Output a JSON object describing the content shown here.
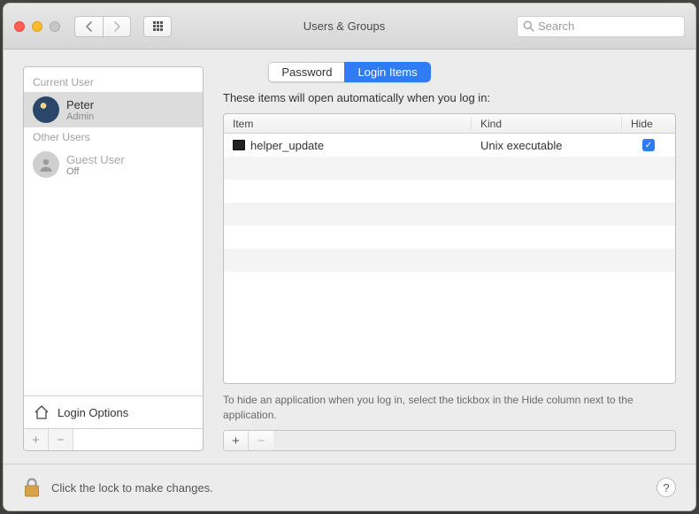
{
  "window": {
    "title": "Users & Groups"
  },
  "search": {
    "placeholder": "Search"
  },
  "tabs": {
    "password": "Password",
    "login_items": "Login Items"
  },
  "sidebar": {
    "current_label": "Current User",
    "other_label": "Other Users",
    "peter": {
      "name": "Peter",
      "role": "Admin"
    },
    "guest": {
      "name": "Guest User",
      "role": "Off"
    },
    "login_options": "Login Options"
  },
  "table": {
    "explain": "These items will open automatically when you log in:",
    "headers": {
      "item": "Item",
      "kind": "Kind",
      "hide": "Hide"
    },
    "rows": [
      {
        "name": "helper_update",
        "kind": "Unix executable",
        "hide": true
      }
    ],
    "hint": "To hide an application when you log in, select the tickbox in the Hide column next to the application."
  },
  "footer": {
    "lock_text": "Click the lock to make changes."
  },
  "glyphs": {
    "plus": "+",
    "minus": "−",
    "question": "?",
    "check": "✓"
  }
}
